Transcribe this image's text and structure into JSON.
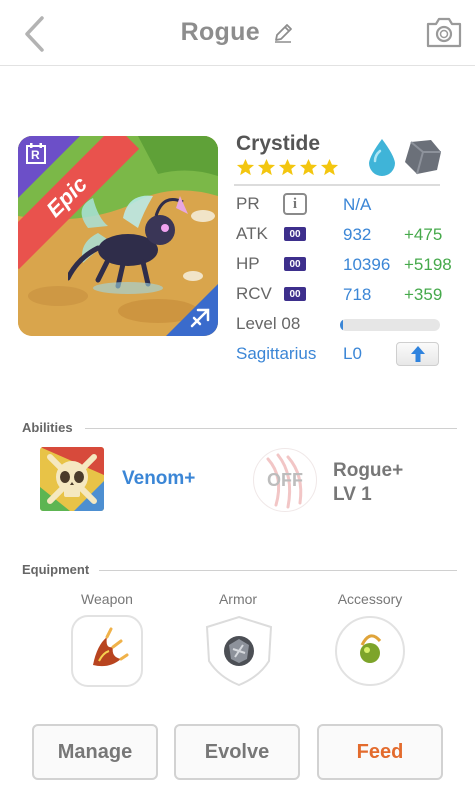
{
  "header": {
    "title": "Rogue",
    "back_icon": "chevron-left-icon",
    "edit_icon": "pencil-icon",
    "camera_icon": "camera-icon"
  },
  "hero": {
    "rarity": "Epic",
    "rarity_badge": "R",
    "name": "Crystide",
    "stars": 5,
    "elements": [
      "water-drop-icon",
      "stone-icon"
    ],
    "zodiac_icon": "sagittarius-icon",
    "colors": {
      "rarity_ribbon": "#e9524d",
      "rarity_corner": "#6c4fc8",
      "zodiac_corner": "#3a6bcc",
      "star": "#f3c60f"
    }
  },
  "stats": {
    "pr": {
      "label": "PR",
      "value": "N/A"
    },
    "atk": {
      "label": "ATK",
      "badge": "00",
      "value": "932",
      "bonus": "+475"
    },
    "hp": {
      "label": "HP",
      "badge": "00",
      "value": "10396",
      "bonus": "+5198"
    },
    "rcv": {
      "label": "RCV",
      "badge": "00",
      "value": "718",
      "bonus": "+359"
    },
    "level": {
      "label": "Level 08",
      "progress": 0.03
    },
    "sign": {
      "label": "Sagittarius",
      "level": "L0"
    },
    "colors": {
      "value": "#3b86d6",
      "bonus": "#46a94b"
    }
  },
  "abilities": {
    "title": "Abilities",
    "items": [
      {
        "name": "Venom+"
      },
      {
        "state": "OFF",
        "name_line1": "Rogue+",
        "name_line2": "LV 1"
      }
    ]
  },
  "equipment": {
    "title": "Equipment",
    "slots": [
      {
        "label": "Weapon"
      },
      {
        "label": "Armor"
      },
      {
        "label": "Accessory"
      }
    ]
  },
  "actions": {
    "manage": "Manage",
    "evolve": "Evolve",
    "feed": "Feed"
  }
}
